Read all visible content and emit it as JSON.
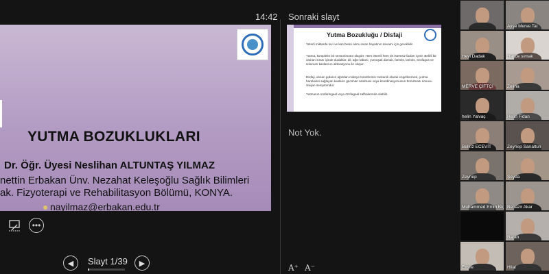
{
  "presenter": {
    "time": "14:42",
    "next_slide_label": "Sonraki slayt",
    "notes": "Not Yok.",
    "slide_counter": "Slayt 1/39",
    "progress": 0.026,
    "font_larger": "A⁺",
    "font_smaller": "A⁻"
  },
  "current_slide": {
    "title": "YUTMA BOZUKLUKLARI",
    "author": "Dr. Öğr. Üyesi Neslihan ALTUNTAŞ YILMAZ",
    "institution_line1": "nettin Erbakan Ünv. Nezahat Keleşoğlu Sağlık Bilimleri",
    "institution_line2": "ak. Fizyoterapi ve Rehabilitasyon Bölümü, KONYA.",
    "email": "nayilmaz@erbakan.edu.tr"
  },
  "next_slide": {
    "title": "Yutma Bozukluğu / Disfaji",
    "paragraphs": [
      "Yeterli miktarda sıvı ve katı besin alımı insan hayatının devamı için gereklidir.",
      "Yutma, kompleks bir sensorimotor olaydır. Hem istemli hem de istemsiz fazları içerir. Belirli bir zaman sırası içinde dudaklar, dil, ağız tabanı, yumuşak damak, farinks, larinks, özofagus ve solunum kaslarının aktivasyonu ile oluşur.",
      "Disfaji, alınan gıdanın ağızdan mideye transferinin mekanik olarak engellenmesi, yutma hareketini sağlayan kasların gücünün azalması veya koordinasyonunun bozulması sonucu oluşan semptomdur.",
      "Yutmanın orofaringeal veya özofageal safhalarında olabilir."
    ]
  },
  "participants": [
    {
      "name": "",
      "bg": "#6e6a6a",
      "body": "#2b2b2b"
    },
    {
      "name": "Ayşe Merve Tat",
      "bg": "#8a8580",
      "body": "#3b3b3b"
    },
    {
      "name": "Hevi Dadak",
      "bg": "#9a8f86",
      "body": "#222"
    },
    {
      "name": "Hatice sımak",
      "bg": "#d9d4cf",
      "body": "#5a4f4a"
    },
    {
      "name": "MERVE ÇİFTÇİ",
      "bg": "#7a6a60",
      "body": "#6b3a3a"
    },
    {
      "name": "Zeliha",
      "bg": "#a89a90",
      "body": "#3a3a3a"
    },
    {
      "name": "helin Yalvaç",
      "bg": "#2a2a2a",
      "body": "#1a1a1a"
    },
    {
      "name": "Helin Fidan",
      "bg": "#b0aca8",
      "body": "#4a4a4a"
    },
    {
      "name": "Belkız ECEVİT",
      "bg": "#8c7f78",
      "body": "#1e1e1e"
    },
    {
      "name": "Zeynep Sarıaltun",
      "bg": "#5a524e",
      "body": "#2e2e2e"
    },
    {
      "name": "Zeynep",
      "bg": "#7a726c",
      "body": "#333"
    },
    {
      "name": "Şeyda",
      "bg": "#a39689",
      "body": "#2a2a2a"
    },
    {
      "name": "Muhammed Emin Biçer",
      "bg": "#8f8a85",
      "body": "#4b4b4b"
    },
    {
      "name": "Benazir Akar",
      "bg": "#9c948e",
      "body": "#222"
    },
    {
      "name": "",
      "bg": "#0a0a0a",
      "body": "#0a0a0a"
    },
    {
      "name": "Baran",
      "bg": "#b5b0ab",
      "body": "#3a3a3a"
    },
    {
      "name": "Emire",
      "bg": "#c4bdb5",
      "body": "#2d2d2d"
    },
    {
      "name": "Hilal",
      "bg": "#6d625c",
      "body": "#333"
    }
  ]
}
